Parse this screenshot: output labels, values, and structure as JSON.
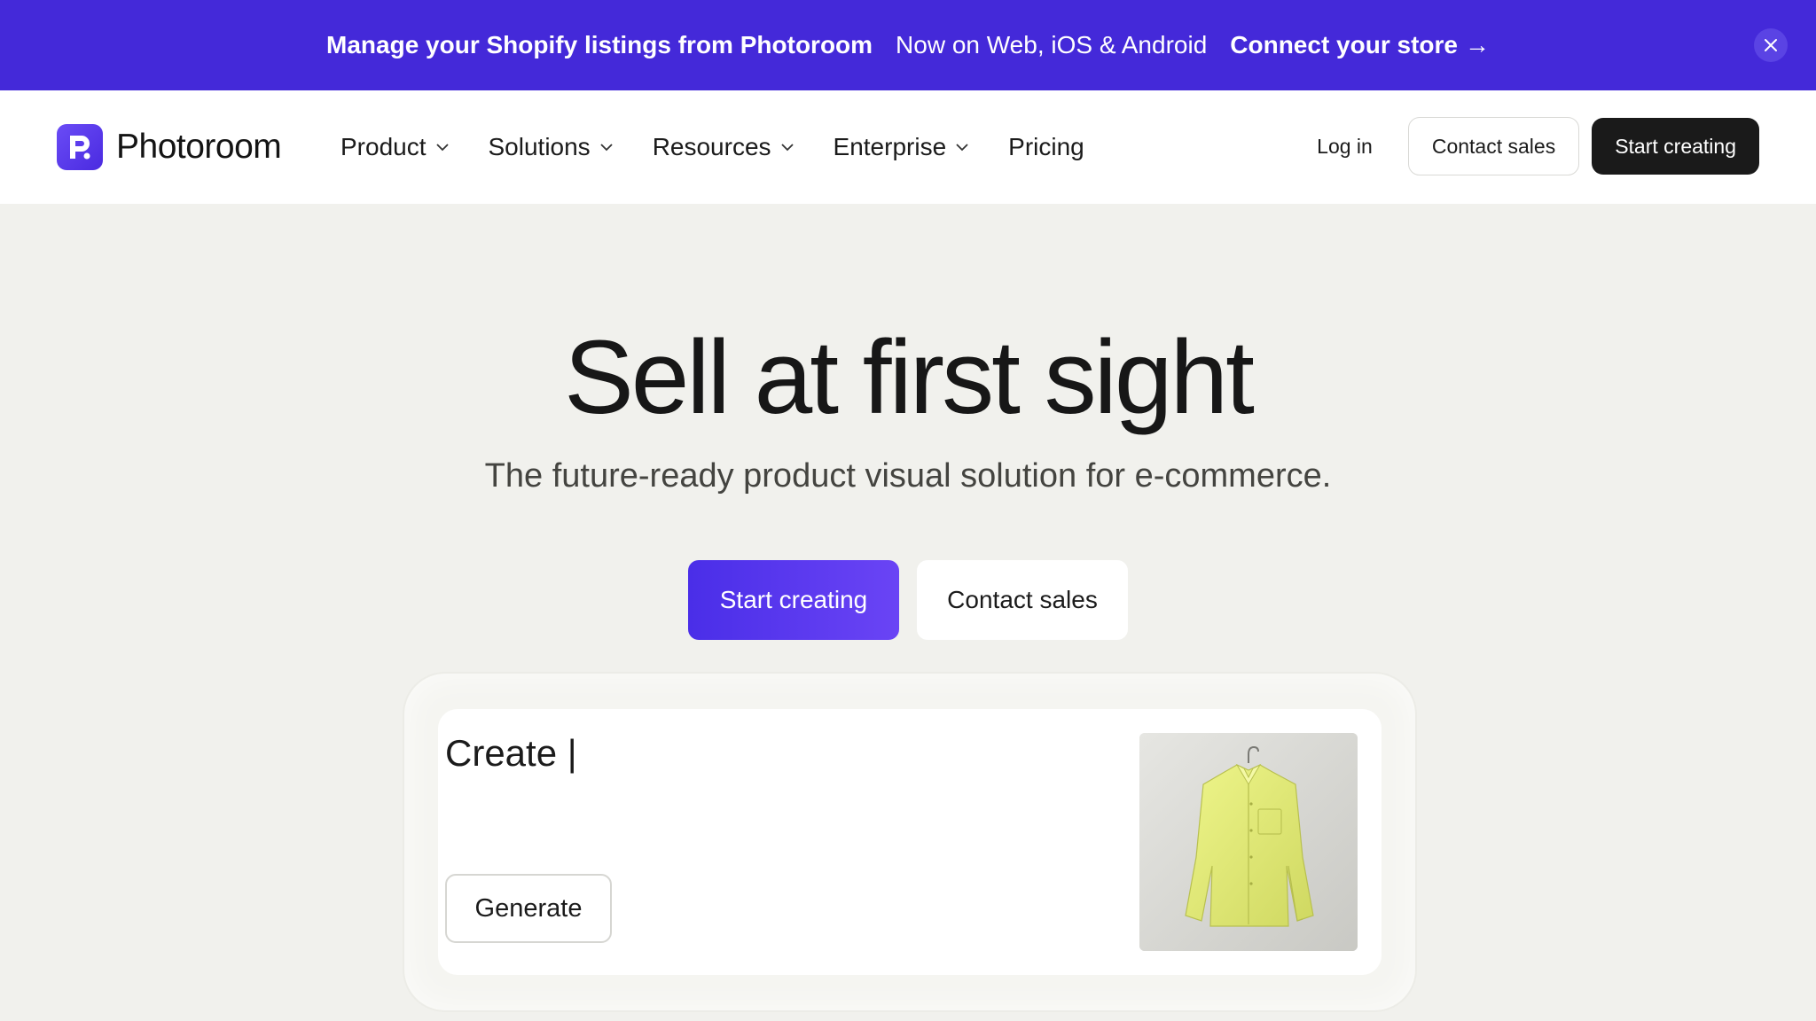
{
  "banner": {
    "promo": "Manage your Shopify listings from Photoroom",
    "platforms": "Now on Web, iOS & Android",
    "cta": "Connect your store",
    "cta_arrow": "→",
    "close_icon": "close-icon"
  },
  "nav": {
    "brand": "Photoroom",
    "menu": [
      {
        "label": "Product",
        "has_dropdown": true
      },
      {
        "label": "Solutions",
        "has_dropdown": true
      },
      {
        "label": "Resources",
        "has_dropdown": true
      },
      {
        "label": "Enterprise",
        "has_dropdown": true
      },
      {
        "label": "Pricing",
        "has_dropdown": false
      }
    ],
    "login": "Log in",
    "contact_sales": "Contact sales",
    "start_creating": "Start creating"
  },
  "hero": {
    "title": "Sell at first sight",
    "subtitle": "The future-ready product visual solution for e-commerce.",
    "primary_cta": "Start creating",
    "secondary_cta": "Contact sales"
  },
  "demo": {
    "prompt": "Create |",
    "generate_label": "Generate",
    "image_subject": "yellow-shirt-on-hanger"
  },
  "colors": {
    "brand": "#4429d9",
    "brand_gradient_end": "#6a44f5",
    "dark_button": "#1a1a1a",
    "page_bg": "#f1f1ed"
  }
}
